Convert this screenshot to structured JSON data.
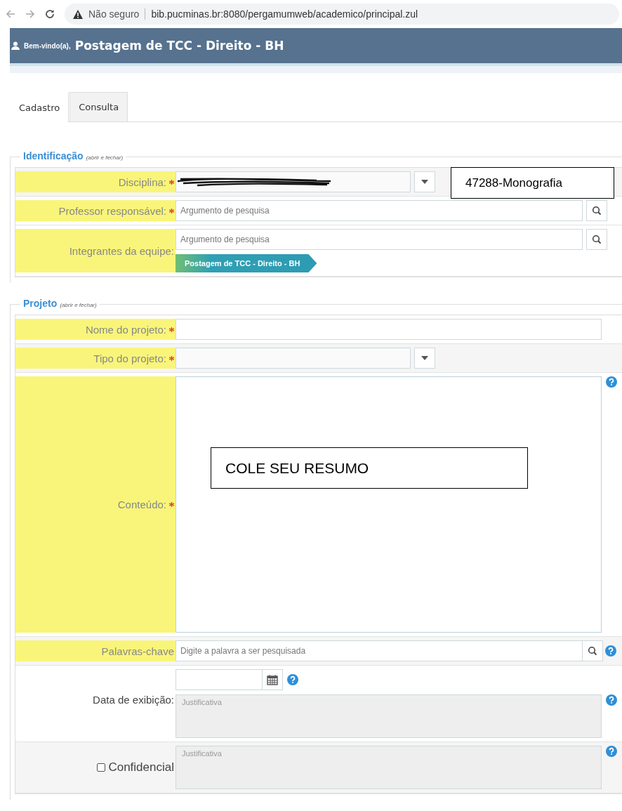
{
  "browser": {
    "security": "Não seguro",
    "url": "bib.pucminas.br:8080/pergamumweb/academico/principal.zul"
  },
  "header": {
    "greeting": "Bem-vindo(a),",
    "title": "Postagem de TCC - Direito - BH"
  },
  "tabs": [
    {
      "label": "Cadastro",
      "selected": true
    },
    {
      "label": "Consulta",
      "selected": false
    }
  ],
  "sections": [
    {
      "title": "Identificação",
      "toggle": "(abrir e fechar)",
      "rows": [
        {
          "kind": "select",
          "label": "Disciplina:",
          "required": true,
          "highlighted": true,
          "redacted": true
        },
        {
          "kind": "search",
          "label": "Professor responsável:",
          "required": true,
          "highlighted": true,
          "placeholder": "Argumento de pesquisa"
        },
        {
          "kind": "search",
          "label": "Integrantes da equipe:",
          "required": false,
          "highlighted": true,
          "placeholder": "Argumento de pesquisa",
          "tag": "Postagem de TCC - Direito - BH"
        }
      ]
    },
    {
      "title": "Projeto",
      "toggle": "(abrir e fechar)",
      "rows": [
        {
          "kind": "text",
          "label": "Nome do projeto:",
          "required": true,
          "highlighted": true
        },
        {
          "kind": "select",
          "label": "Tipo do projeto:",
          "required": true,
          "highlighted": true,
          "redacted": false
        },
        {
          "kind": "textarea",
          "label": "Conteúdo:",
          "required": true,
          "highlighted": true,
          "help": true
        },
        {
          "kind": "search",
          "label": "Palavras-chave",
          "required": false,
          "highlighted": true,
          "placeholder": "Digite a palavra a ser pesquisada",
          "help": true
        },
        {
          "kind": "date",
          "label": "Data de exibição:",
          "required": false,
          "highlighted": false,
          "placeholder": "Justificativa",
          "help": true
        },
        {
          "kind": "checkbox",
          "label": "Confidencial",
          "checked": false,
          "highlighted": false,
          "placeholder": "Justificativa",
          "help": true
        }
      ]
    }
  ],
  "annotations": [
    {
      "text": "47288-Monografia"
    },
    {
      "text": "COLE SEU RESUMO"
    }
  ]
}
